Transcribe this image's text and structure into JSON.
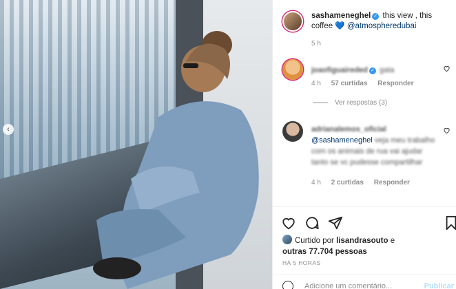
{
  "post": {
    "username": "sashameneghel",
    "caption_text": "this view , this coffee",
    "caption_heart": "💙",
    "caption_tag": "@atmospheredubai",
    "time": "5 h"
  },
  "comments": [
    {
      "username": "joaofiguaireded",
      "text": "gata",
      "time": "4 h",
      "likes": "57 curtidas",
      "reply_label": "Responder"
    },
    {
      "username": "adrianalemos_oficial",
      "text_mention": "@sashameneghel",
      "text": "veja meu trabalho com os animais de rua",
      "text2": "vai ajudar tanto se vc pudesse compartilhar",
      "time": "4 h",
      "likes": "2 curtidas",
      "reply_label": "Responder"
    }
  ],
  "view_replies": "Ver respostas (3)",
  "liked_by": {
    "prefix": "Curtido por",
    "user": "lisandrasouto",
    "conj": "e",
    "others": "outras 77.704 pessoas"
  },
  "posted_ago": "HÁ 5 HORAS",
  "add_comment": {
    "placeholder": "Adicione um comentário...",
    "publish_label": "Publicar"
  },
  "icons": [
    "heart-icon",
    "comment-icon",
    "share-icon",
    "bookmark-icon",
    "emoji-icon",
    "verified-icon",
    "chevron-left-icon"
  ],
  "colors": {
    "verified": "#3897f0",
    "link": "#00376b",
    "publish": "#b2dffc"
  }
}
